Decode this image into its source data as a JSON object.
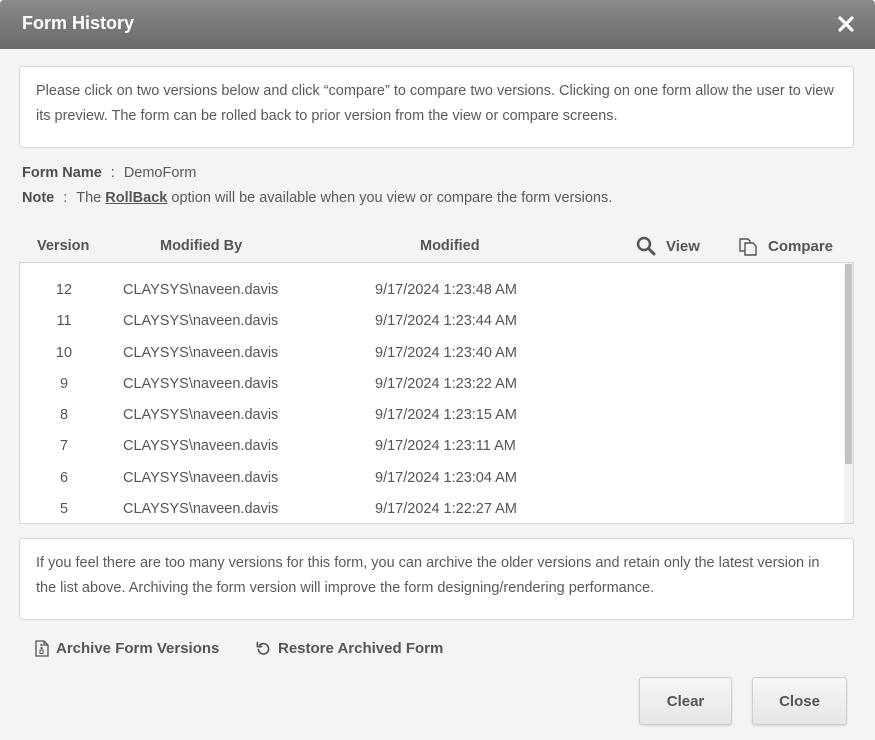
{
  "dialog": {
    "title": "Form History"
  },
  "info": {
    "text": "Please click on two versions below and click “compare” to compare two versions. Clicking on one form allow the user to view its preview. The form can be rolled back to prior version from the view or compare screens."
  },
  "form": {
    "name_label": "Form Name",
    "separator": ":",
    "name_value": "DemoForm",
    "note_label": "Note",
    "note_prefix": "The",
    "note_link": "RollBack",
    "note_suffix": "option will be available when you view or compare the form versions."
  },
  "table": {
    "columns": [
      "Version",
      "Modified By",
      "Modified"
    ],
    "view_label": "View",
    "compare_label": "Compare",
    "rows": [
      {
        "version": "12",
        "modified_by": "CLAYSYS\\naveen.davis",
        "modified": "9/17/2024 1:23:48 AM"
      },
      {
        "version": "11",
        "modified_by": "CLAYSYS\\naveen.davis",
        "modified": "9/17/2024 1:23:44 AM"
      },
      {
        "version": "10",
        "modified_by": "CLAYSYS\\naveen.davis",
        "modified": "9/17/2024 1:23:40 AM"
      },
      {
        "version": "9",
        "modified_by": "CLAYSYS\\naveen.davis",
        "modified": "9/17/2024 1:23:22 AM"
      },
      {
        "version": "8",
        "modified_by": "CLAYSYS\\naveen.davis",
        "modified": "9/17/2024 1:23:15 AM"
      },
      {
        "version": "7",
        "modified_by": "CLAYSYS\\naveen.davis",
        "modified": "9/17/2024 1:23:11 AM"
      },
      {
        "version": "6",
        "modified_by": "CLAYSYS\\naveen.davis",
        "modified": "9/17/2024 1:23:04 AM"
      },
      {
        "version": "5",
        "modified_by": "CLAYSYS\\naveen.davis",
        "modified": "9/17/2024 1:22:27 AM"
      }
    ]
  },
  "archive": {
    "text": "If you feel there are too many versions for this form, you can archive the older versions and retain only the latest version in the list above. Archiving the form version will improve the form designing/rendering performance.",
    "archive_label": "Archive Form Versions",
    "restore_label": "Restore Archived Form"
  },
  "buttons": {
    "clear_label": "Clear",
    "close_label": "Close"
  },
  "icons": {
    "close": "close-icon",
    "view": "search-icon",
    "compare": "compare-icon",
    "archive": "archive-file-icon",
    "restore": "restore-icon"
  },
  "colors": {
    "titlebar": "#777777",
    "background": "#f4f4f4",
    "text": "#555555"
  }
}
